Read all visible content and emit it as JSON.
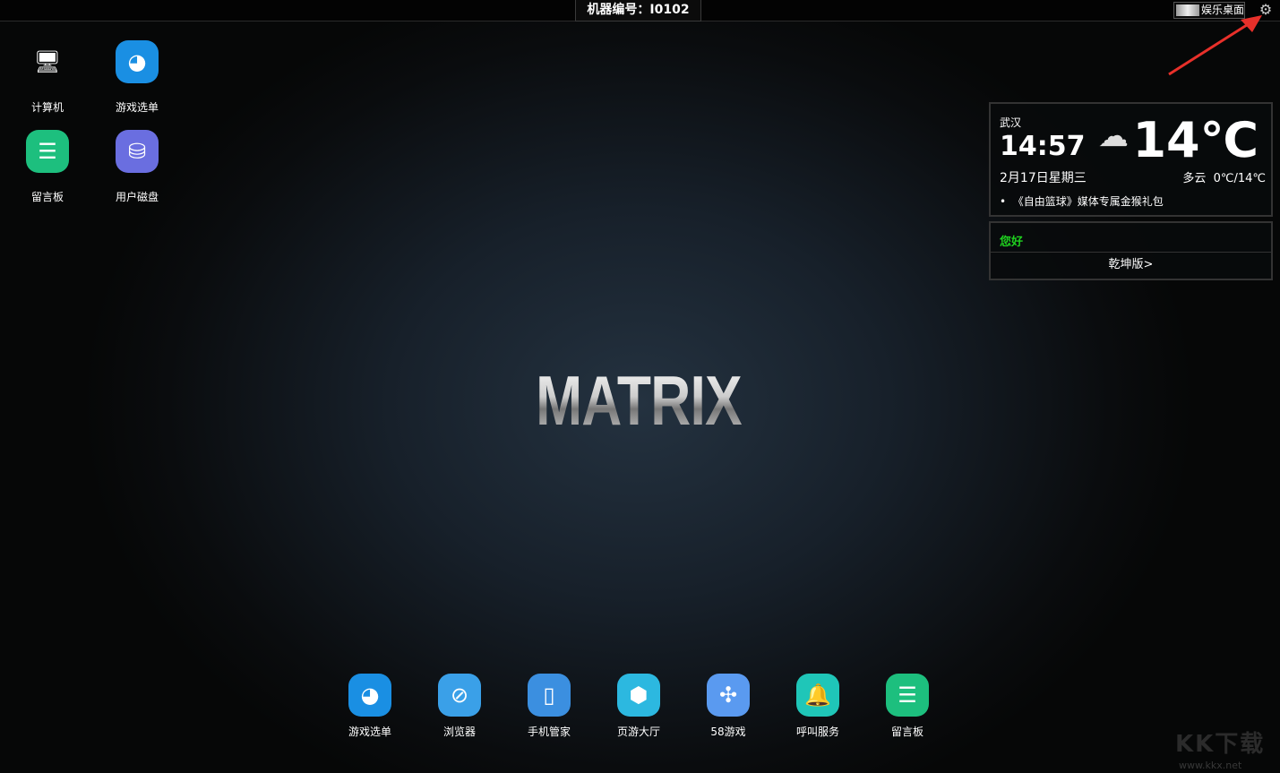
{
  "topbar": {
    "machine_label": "机器编号：I0102",
    "mode_button": "娱乐桌面",
    "settings_icon": "gear-icon"
  },
  "desktop": [
    {
      "label": "计算机",
      "icon": "computer-icon",
      "color": "#2a4fbf"
    },
    {
      "label": "游戏选单",
      "icon": "whale-icon",
      "color": "#1a8fe3"
    },
    {
      "label": "留言板",
      "icon": "notepad-icon",
      "color": "#1dbf7e"
    },
    {
      "label": "用户磁盘",
      "icon": "disk-icon",
      "color": "#6a6ee0"
    }
  ],
  "weather": {
    "city": "武汉",
    "time": "14:57",
    "date": "2月17日星期三",
    "temp": "14℃",
    "condition": "多云",
    "range": "0℃/14℃",
    "news": "《自由篮球》媒体专属金猴礼包"
  },
  "greeting": {
    "text": "您好",
    "version_link": "乾坤版>"
  },
  "logo": "MATRIX",
  "dock": [
    {
      "label": "游戏选单",
      "icon": "whale-icon",
      "color": "#1a8fe3",
      "glyph": "◕"
    },
    {
      "label": "浏览器",
      "icon": "browser-icon",
      "color": "#3aa0e8",
      "glyph": "⊘"
    },
    {
      "label": "手机管家",
      "icon": "phone-icon",
      "color": "#3b8fe0",
      "glyph": "▯"
    },
    {
      "label": "页游大厅",
      "icon": "cube-icon",
      "color": "#2cb8e0",
      "glyph": "⬢"
    },
    {
      "label": "58游戏",
      "icon": "game58-icon",
      "color": "#5a9af0",
      "glyph": "✣"
    },
    {
      "label": "呼叫服务",
      "icon": "bell-icon",
      "color": "#1fc6b8",
      "glyph": "🔔"
    },
    {
      "label": "留言板",
      "icon": "notepad-icon",
      "color": "#1dbf7e",
      "glyph": "☰"
    }
  ],
  "watermark": {
    "text": "KK下载",
    "url": "www.kkx.net"
  }
}
